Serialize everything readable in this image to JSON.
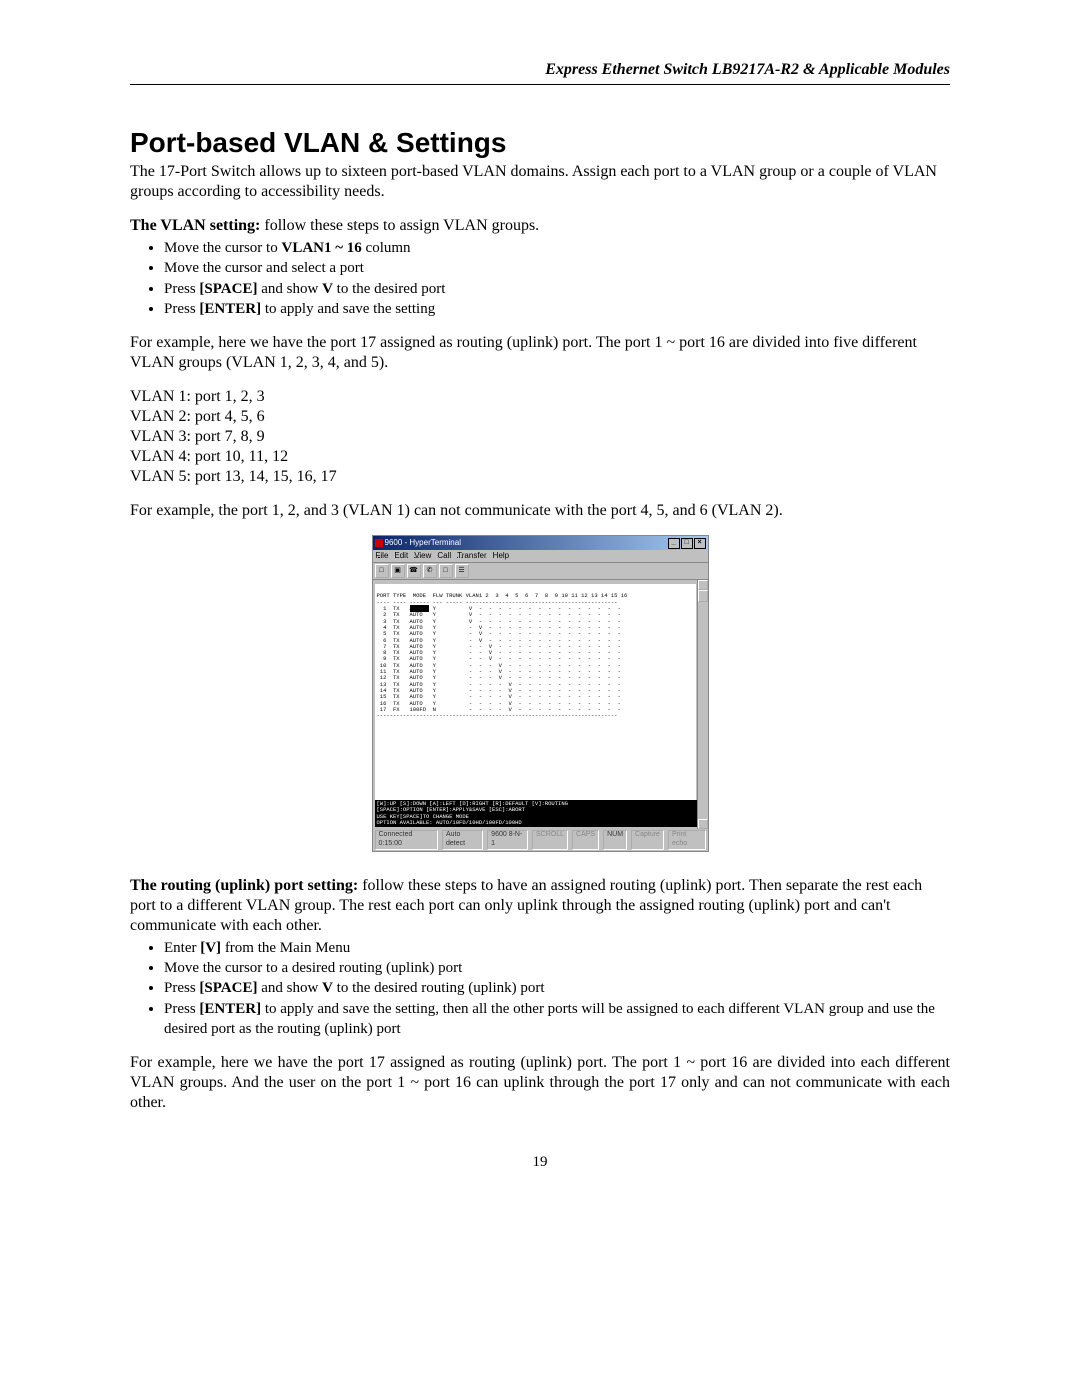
{
  "header": {
    "doc_title": "Express Ethernet Switch LB9217A-R2 & Applicable Modules"
  },
  "title": "Port-based VLAN & Settings",
  "intro": "The 17-Port Switch allows up to sixteen port-based VLAN domains. Assign each port to a VLAN group or a couple of VLAN groups according to accessibility needs.",
  "vlan_setting_label": "The VLAN setting:",
  "vlan_setting_follow": " follow these steps to assign VLAN groups.",
  "bullets1": [
    {
      "pre": "Move the cursor to ",
      "b": "VLAN1 ~ 16",
      "post": " column"
    },
    {
      "pre": "Move the cursor and select a port",
      "b": "",
      "post": ""
    },
    {
      "pre": "Press ",
      "b": "[SPACE]",
      "post": " and show ",
      "b2": "V",
      "post2": " to the desired port"
    },
    {
      "pre": "Press ",
      "b": "[ENTER]",
      "post": " to apply and save the setting"
    }
  ],
  "para_example1": "For example, here we have the port 17 assigned as routing (uplink) port. The port 1 ~ port 16 are divided into five different VLAN groups (VLAN 1, 2, 3, 4, and 5).",
  "vlan_lines": [
    "VLAN 1: port 1, 2, 3",
    "VLAN 2: port 4, 5, 6",
    "VLAN 3: port 7, 8, 9",
    "VLAN 4: port 10, 11, 12",
    "VLAN 5: port 13, 14, 15, 16, 17"
  ],
  "para_example2": "For example, the port 1, 2, and 3 (VLAN 1) can not communicate with the port 4, 5, and 6 (VLAN 2).",
  "screenshot": {
    "window_title": "9600 - HyperTerminal",
    "menus": [
      "File",
      "Edit",
      "View",
      "Call",
      "Transfer",
      "Help"
    ],
    "terminal_header": "PORT TYPE  MODE  FLW TRUNK VLAN1 2  3  4  5  6  7  8  9 10 11 12 13 14 15 16",
    "rows": [
      {
        "p": "1",
        "t": "TX",
        "m": "AUTO",
        "f": "Y",
        "v": [
          "V",
          "-",
          "-",
          "-",
          "-",
          "-",
          "-",
          "-",
          "-",
          "-",
          "-",
          "-",
          "-",
          "-",
          "-",
          "-"
        ],
        "hl": true
      },
      {
        "p": "2",
        "t": "TX",
        "m": "AUTO",
        "f": "Y",
        "v": [
          "V",
          "-",
          "-",
          "-",
          "-",
          "-",
          "-",
          "-",
          "-",
          "-",
          "-",
          "-",
          "-",
          "-",
          "-",
          "-"
        ]
      },
      {
        "p": "3",
        "t": "TX",
        "m": "AUTO",
        "f": "Y",
        "v": [
          "V",
          "-",
          "-",
          "-",
          "-",
          "-",
          "-",
          "-",
          "-",
          "-",
          "-",
          "-",
          "-",
          "-",
          "-",
          "-"
        ]
      },
      {
        "p": "4",
        "t": "TX",
        "m": "AUTO",
        "f": "Y",
        "v": [
          "-",
          "V",
          "-",
          "-",
          "-",
          "-",
          "-",
          "-",
          "-",
          "-",
          "-",
          "-",
          "-",
          "-",
          "-",
          "-"
        ]
      },
      {
        "p": "5",
        "t": "TX",
        "m": "AUTO",
        "f": "Y",
        "v": [
          "-",
          "V",
          "-",
          "-",
          "-",
          "-",
          "-",
          "-",
          "-",
          "-",
          "-",
          "-",
          "-",
          "-",
          "-",
          "-"
        ]
      },
      {
        "p": "6",
        "t": "TX",
        "m": "AUTO",
        "f": "Y",
        "v": [
          "-",
          "V",
          "-",
          "-",
          "-",
          "-",
          "-",
          "-",
          "-",
          "-",
          "-",
          "-",
          "-",
          "-",
          "-",
          "-"
        ]
      },
      {
        "p": "7",
        "t": "TX",
        "m": "AUTO",
        "f": "Y",
        "v": [
          "-",
          "-",
          "V",
          "-",
          "-",
          "-",
          "-",
          "-",
          "-",
          "-",
          "-",
          "-",
          "-",
          "-",
          "-",
          "-"
        ]
      },
      {
        "p": "8",
        "t": "TX",
        "m": "AUTO",
        "f": "Y",
        "v": [
          "-",
          "-",
          "V",
          "-",
          "-",
          "-",
          "-",
          "-",
          "-",
          "-",
          "-",
          "-",
          "-",
          "-",
          "-",
          "-"
        ]
      },
      {
        "p": "9",
        "t": "TX",
        "m": "AUTO",
        "f": "Y",
        "v": [
          "-",
          "-",
          "V",
          "-",
          "-",
          "-",
          "-",
          "-",
          "-",
          "-",
          "-",
          "-",
          "-",
          "-",
          "-",
          "-"
        ]
      },
      {
        "p": "10",
        "t": "TX",
        "m": "AUTO",
        "f": "Y",
        "v": [
          "-",
          "-",
          "-",
          "V",
          "-",
          "-",
          "-",
          "-",
          "-",
          "-",
          "-",
          "-",
          "-",
          "-",
          "-",
          "-"
        ]
      },
      {
        "p": "11",
        "t": "TX",
        "m": "AUTO",
        "f": "Y",
        "v": [
          "-",
          "-",
          "-",
          "V",
          "-",
          "-",
          "-",
          "-",
          "-",
          "-",
          "-",
          "-",
          "-",
          "-",
          "-",
          "-"
        ]
      },
      {
        "p": "12",
        "t": "TX",
        "m": "AUTO",
        "f": "Y",
        "v": [
          "-",
          "-",
          "-",
          "V",
          "-",
          "-",
          "-",
          "-",
          "-",
          "-",
          "-",
          "-",
          "-",
          "-",
          "-",
          "-"
        ]
      },
      {
        "p": "13",
        "t": "TX",
        "m": "AUTO",
        "f": "Y",
        "v": [
          "-",
          "-",
          "-",
          "-",
          "V",
          "-",
          "-",
          "-",
          "-",
          "-",
          "-",
          "-",
          "-",
          "-",
          "-",
          "-"
        ]
      },
      {
        "p": "14",
        "t": "TX",
        "m": "AUTO",
        "f": "Y",
        "v": [
          "-",
          "-",
          "-",
          "-",
          "V",
          "-",
          "-",
          "-",
          "-",
          "-",
          "-",
          "-",
          "-",
          "-",
          "-",
          "-"
        ]
      },
      {
        "p": "15",
        "t": "TX",
        "m": "AUTO",
        "f": "Y",
        "v": [
          "-",
          "-",
          "-",
          "-",
          "V",
          "-",
          "-",
          "-",
          "-",
          "-",
          "-",
          "-",
          "-",
          "-",
          "-",
          "-"
        ]
      },
      {
        "p": "16",
        "t": "TX",
        "m": "AUTO",
        "f": "Y",
        "v": [
          "-",
          "-",
          "-",
          "-",
          "V",
          "-",
          "-",
          "-",
          "-",
          "-",
          "-",
          "-",
          "-",
          "-",
          "-",
          "-"
        ]
      },
      {
        "p": "17",
        "t": "FX",
        "m": "100FD",
        "f": "N",
        "v": [
          "-",
          "-",
          "-",
          "-",
          "V",
          "-",
          "-",
          "-",
          "-",
          "-",
          "-",
          "-",
          "-",
          "-",
          "-",
          "-"
        ]
      }
    ],
    "footer_lines": [
      "[W]:UP [S]:DOWN [A]:LEFT [D]:RIGHT [R]:DEFAULT [V]:ROUTING",
      "[SPACE]:OPTION [ENTER]:APPLY&SAVE [ESC]:ABORT",
      "USE KEY[SPACE]TO CHANGE MODE",
      "OPTION AVAILABLE: AUTO/10FD/10HD/100FD/100HD"
    ],
    "status": [
      "Connected 0:15:00",
      "Auto detect",
      "9600 8-N-1",
      "SCROLL",
      "CAPS",
      "NUM",
      "Capture",
      "Print echo"
    ]
  },
  "routing_label": "The routing (uplink) port setting:",
  "routing_follow": " follow these steps to have an assigned routing (uplink) port. Then separate the rest each port to a different VLAN group. The rest each port can only uplink through the assigned routing (uplink) port and can't communicate with each other.",
  "bullets2": [
    {
      "pre": "Enter ",
      "b": "[V]",
      "post": " from the Main Menu"
    },
    {
      "pre": "Move the cursor to a desired routing (uplink) port",
      "b": "",
      "post": ""
    },
    {
      "pre": "Press ",
      "b": "[SPACE]",
      "post": " and show ",
      "b2": "V",
      "post2": " to the desired routing (uplink) port"
    },
    {
      "pre": "Press ",
      "b": "[ENTER]",
      "post": " to apply and save the setting, then all the other ports will be assigned to each different VLAN group and use the desired port as the routing (uplink) port"
    }
  ],
  "para_example3": "For example, here we have the port 17 assigned as routing (uplink) port. The port 1 ~ port 16 are divided into each different VLAN groups. And the user on the port 1 ~ port 16 can uplink through the port 17 only and can not communicate with each other.",
  "page_number": "19"
}
